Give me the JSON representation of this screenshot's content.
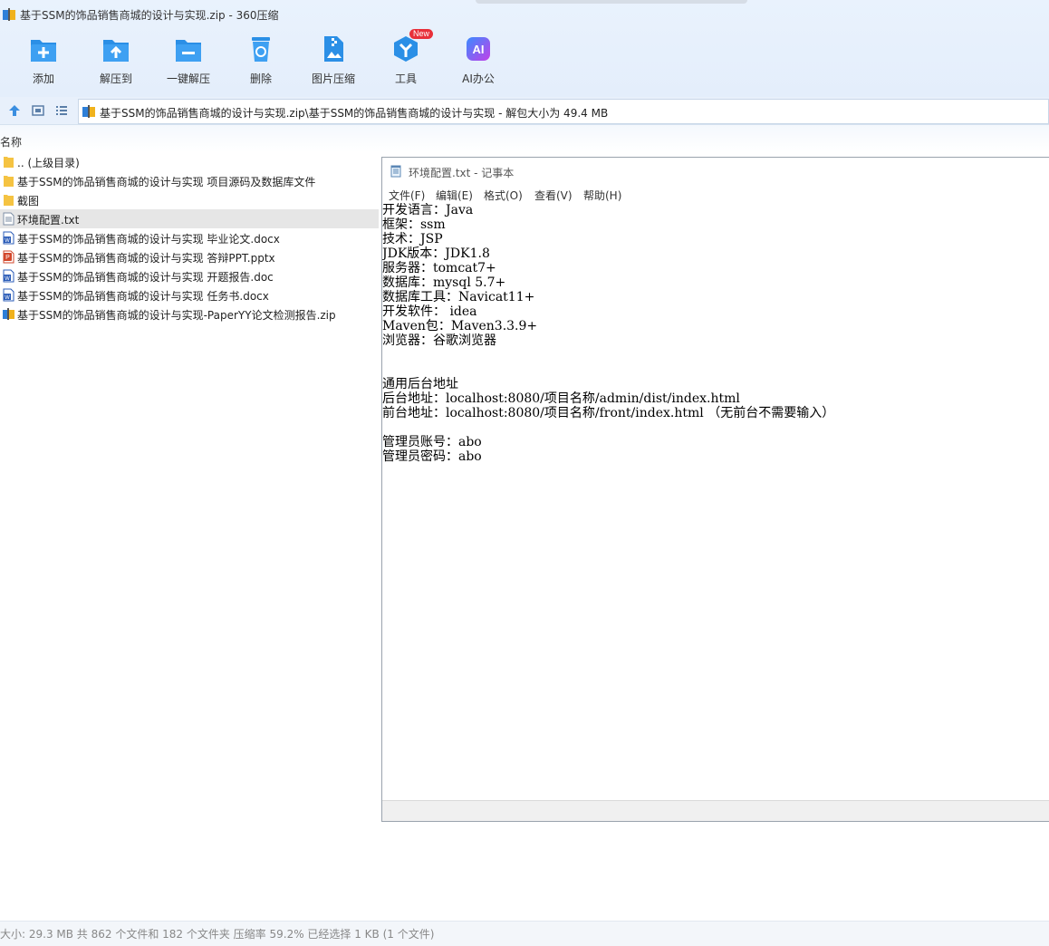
{
  "window": {
    "title": "基于SSM的饰品销售商城的设计与实现.zip - 360压缩"
  },
  "toolbar": {
    "add": "添加",
    "extract_to": "解压到",
    "one_click_extract": "一键解压",
    "delete": "删除",
    "image_compress": "图片压缩",
    "tools": "工具",
    "tools_badge": "New",
    "ai_office": "AI办公"
  },
  "address": {
    "path": "基于SSM的饰品销售商城的设计与实现.zip\\基于SSM的饰品销售商城的设计与实现 - 解包大小为 49.4 MB"
  },
  "list": {
    "column_name": "名称",
    "files": [
      {
        "name": ".. (上级目录)",
        "icon": "folder-icon"
      },
      {
        "name": "基于SSM的饰品销售商城的设计与实现 项目源码及数据库文件",
        "icon": "folder-icon"
      },
      {
        "name": "截图",
        "icon": "folder-icon"
      },
      {
        "name": "环境配置.txt",
        "icon": "text-file-icon"
      },
      {
        "name": "基于SSM的饰品销售商城的设计与实现 毕业论文.docx",
        "icon": "word-file-icon"
      },
      {
        "name": "基于SSM的饰品销售商城的设计与实现 答辩PPT.pptx",
        "icon": "ppt-file-icon"
      },
      {
        "name": "基于SSM的饰品销售商城的设计与实现 开题报告.doc",
        "icon": "word-file-icon"
      },
      {
        "name": "基于SSM的饰品销售商城的设计与实现 任务书.docx",
        "icon": "word-file-icon"
      },
      {
        "name": "基于SSM的饰品销售商城的设计与实现-PaperYY论文检测报告.zip",
        "icon": "zip-file-icon"
      }
    ]
  },
  "notepad": {
    "title": "环境配置.txt - 记事本",
    "menu": {
      "file": "文件(F)",
      "edit": "编辑(E)",
      "format": "格式(O)",
      "view": "查看(V)",
      "help": "帮助(H)"
    },
    "content": "开发语言：Java\n框架：ssm\n技术：JSP\nJDK版本：JDK1.8\n服务器：tomcat7+\n数据库：mysql 5.7+\n数据库工具：Navicat11+\n开发软件： idea\nMaven包：Maven3.3.9+\n浏览器：谷歌浏览器\n\n\n通用后台地址\n后台地址：localhost:8080/项目名称/admin/dist/index.html\n前台地址：localhost:8080/项目名称/front/index.html （无前台不需要输入）\n\n管理员账号：abo\n管理员密码：abo"
  },
  "status": {
    "text": "大小: 29.3 MB 共 862 个文件和 182 个文件夹 压缩率 59.2% 已经选择 1 KB (1 个文件)"
  },
  "colors": {
    "accent": "#2b8fe6",
    "selected_row": "#e6e6e6",
    "new_badge": "#e8303a"
  }
}
